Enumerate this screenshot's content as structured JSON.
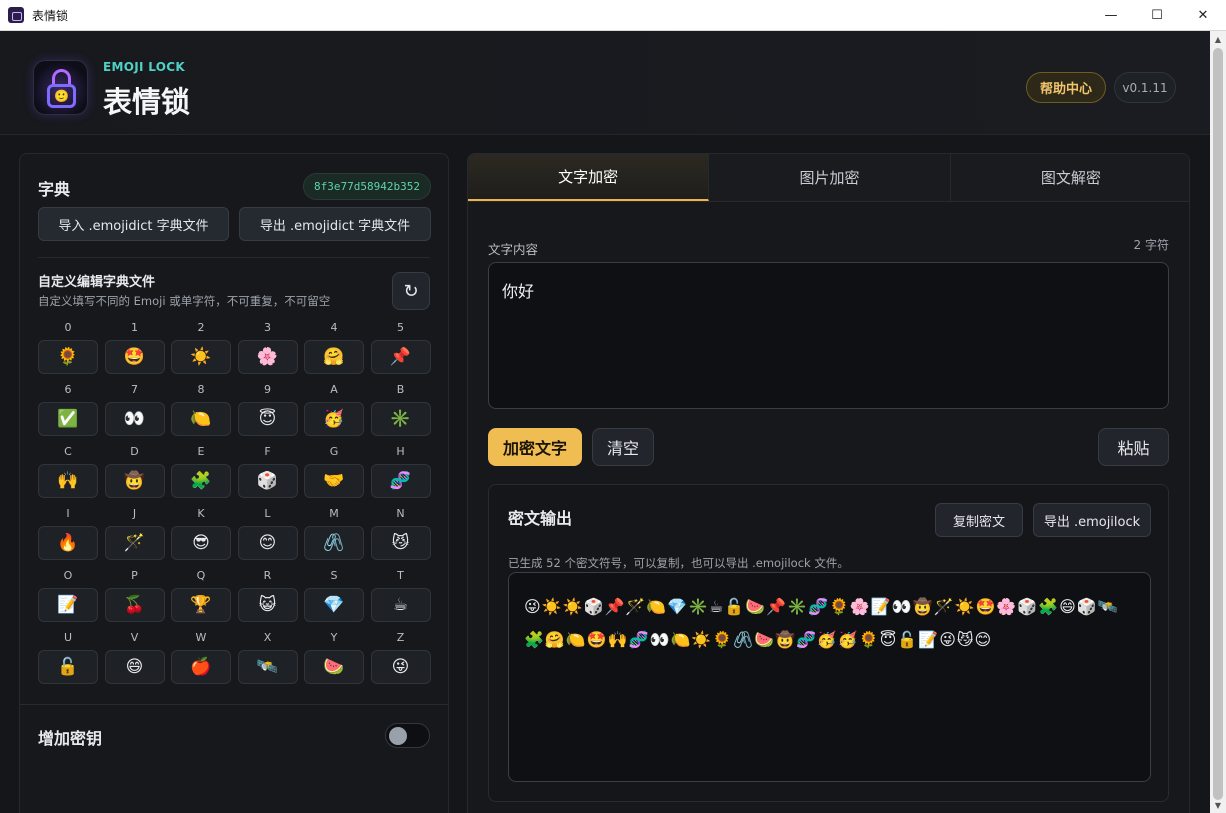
{
  "window": {
    "title": "表情锁",
    "min": "—",
    "max": "☐",
    "close": "✕"
  },
  "header": {
    "brand_sub": "EMOJI LOCK",
    "brand_title": "表情锁",
    "logo_face": "🙂",
    "help": "帮助中心",
    "version": "v0.1.11"
  },
  "dict": {
    "title": "字典",
    "hash": "8f3e77d58942b352",
    "import_label": "导入 .emojidict 字典文件",
    "export_label": "导出 .emojidict 字典文件",
    "custom_title": "自定义编辑字典文件",
    "custom_sub": "自定义填写不同的 Emoji 或单字符，不可重复，不可留空",
    "refresh": "↻",
    "cells": [
      {
        "k": "0",
        "v": "🌻"
      },
      {
        "k": "1",
        "v": "🤩"
      },
      {
        "k": "2",
        "v": "☀️"
      },
      {
        "k": "3",
        "v": "🌸"
      },
      {
        "k": "4",
        "v": "🤗"
      },
      {
        "k": "5",
        "v": "📌"
      },
      {
        "k": "6",
        "v": "✅"
      },
      {
        "k": "7",
        "v": "👀"
      },
      {
        "k": "8",
        "v": "🍋"
      },
      {
        "k": "9",
        "v": "😇"
      },
      {
        "k": "A",
        "v": "🥳"
      },
      {
        "k": "B",
        "v": "✳️"
      },
      {
        "k": "C",
        "v": "🙌"
      },
      {
        "k": "D",
        "v": "🤠"
      },
      {
        "k": "E",
        "v": "🧩"
      },
      {
        "k": "F",
        "v": "🎲"
      },
      {
        "k": "G",
        "v": "🤝"
      },
      {
        "k": "H",
        "v": "🧬"
      },
      {
        "k": "I",
        "v": "🔥"
      },
      {
        "k": "J",
        "v": "🪄"
      },
      {
        "k": "K",
        "v": "😎"
      },
      {
        "k": "L",
        "v": "😊"
      },
      {
        "k": "M",
        "v": "🖇️"
      },
      {
        "k": "N",
        "v": "😼"
      },
      {
        "k": "O",
        "v": "📝"
      },
      {
        "k": "P",
        "v": "🍒"
      },
      {
        "k": "Q",
        "v": "🏆"
      },
      {
        "k": "R",
        "v": "😺"
      },
      {
        "k": "S",
        "v": "💎"
      },
      {
        "k": "T",
        "v": "☕"
      },
      {
        "k": "U",
        "v": "🔓"
      },
      {
        "k": "V",
        "v": "😄"
      },
      {
        "k": "W",
        "v": "🍎"
      },
      {
        "k": "X",
        "v": "🛰️"
      },
      {
        "k": "Y",
        "v": "🍉"
      },
      {
        "k": "Z",
        "v": "😜"
      }
    ]
  },
  "key": {
    "title": "增加密钥",
    "enabled": false
  },
  "tabs": [
    {
      "label": "文字加密",
      "active": true
    },
    {
      "label": "图片加密",
      "active": false
    },
    {
      "label": "图文解密",
      "active": false
    }
  ],
  "encrypt": {
    "label": "文字内容",
    "count": "2 字符",
    "text": "你好",
    "encrypt_btn": "加密文字",
    "clear_btn": "清空",
    "paste_btn": "粘贴"
  },
  "output": {
    "title": "密文输出",
    "copy_btn": "复制密文",
    "export_btn": "导出 .emojilock",
    "info": "已生成 52 个密文符号，可以复制，也可以导出 .emojilock 文件。",
    "text": "😜☀️☀️🎲📌🪄🍋💎✳️☕🔓🍉📌✳️🧬🌻🌸📝👀🤠🪄☀️🤩🌸🎲🧩😄🎲🛰️🧩🤗🍋🤩🙌🧬👀🍋☀️🌻🖇️🍉🤠🧬🥳🥳🌻😇🔓📝😜😼😊"
  }
}
